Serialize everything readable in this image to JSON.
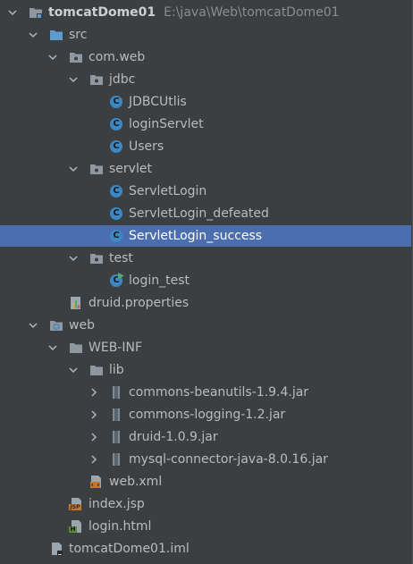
{
  "project": {
    "name": "tomcatDome01",
    "path": "E:\\java\\Web\\tomcatDome01"
  },
  "rows": [
    {
      "label": "src"
    },
    {
      "label": "com.web"
    },
    {
      "label": "jdbc"
    },
    {
      "label": "JDBCUtlis"
    },
    {
      "label": "loginServlet"
    },
    {
      "label": "Users"
    },
    {
      "label": "servlet"
    },
    {
      "label": "ServletLogin"
    },
    {
      "label": "ServletLogin_defeated"
    },
    {
      "label": "ServletLogin_success"
    },
    {
      "label": "test"
    },
    {
      "label": "login_test"
    },
    {
      "label": "druid.properties"
    },
    {
      "label": "web"
    },
    {
      "label": "WEB-INF"
    },
    {
      "label": "lib"
    },
    {
      "label": "commons-beanutils-1.9.4.jar"
    },
    {
      "label": "commons-logging-1.2.jar"
    },
    {
      "label": "druid-1.0.9.jar"
    },
    {
      "label": "mysql-connector-java-8.0.16.jar"
    },
    {
      "label": "web.xml"
    },
    {
      "label": "index.jsp"
    },
    {
      "label": "login.html"
    },
    {
      "label": "tomcatDome01.iml"
    }
  ],
  "icon_badges": {
    "class": "C",
    "jsp": "JSP",
    "html": "H"
  },
  "colors": {
    "background": "#3c3f41",
    "selection": "#4b6eaf",
    "folder": "#8f98a1",
    "class_icon": "#3b88c4",
    "jsp_icon": "#c7782b",
    "html_icon": "#5c8a3c"
  }
}
